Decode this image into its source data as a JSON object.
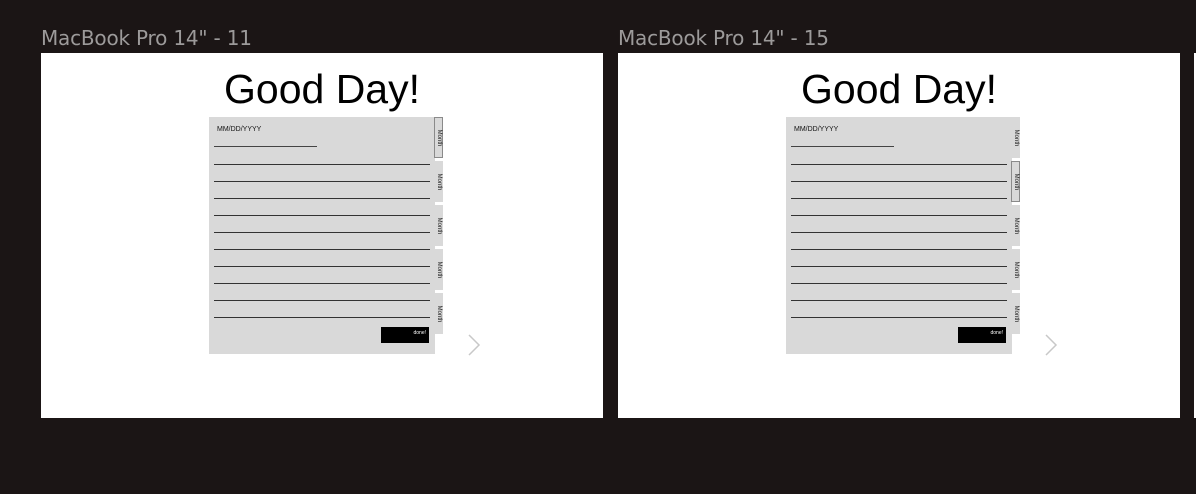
{
  "frames": [
    {
      "label": "MacBook Pro 14\" - 11",
      "title": "Good Day!",
      "date_placeholder": "MM/DD/YYYY",
      "tabs": [
        "Month",
        "Month",
        "Month",
        "Month",
        "Month"
      ],
      "active_tab": 0,
      "done_label": "done!"
    },
    {
      "label": "MacBook Pro 14\" - 15",
      "title": "Good Day!",
      "date_placeholder": "MM/DD/YYYY",
      "tabs": [
        "Month",
        "Month",
        "Month",
        "Month",
        "Month"
      ],
      "active_tab": 1,
      "done_label": "done!"
    }
  ],
  "colors": {
    "canvas": "#1b1515",
    "frame": "#ffffff",
    "card": "#d9d9d9",
    "label": "#9c9a9a",
    "button": "#000000"
  },
  "icons": {
    "next": "chevron-right-icon"
  }
}
